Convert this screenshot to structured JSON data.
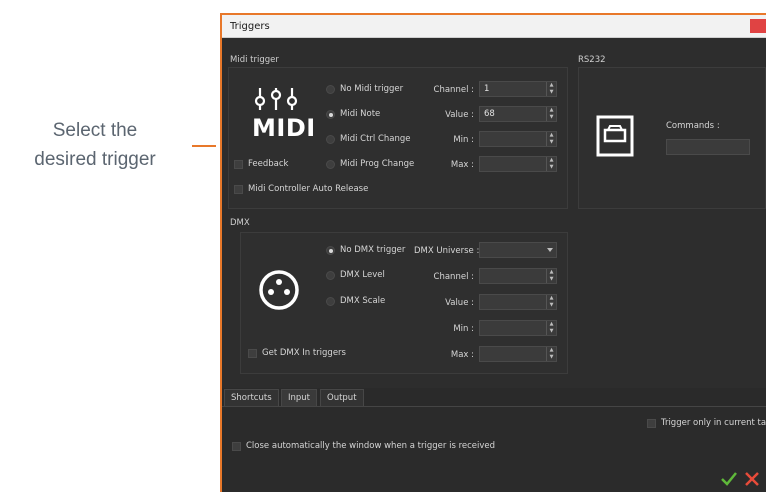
{
  "annotation": {
    "line1": "Select the",
    "line2": "desired trigger"
  },
  "window": {
    "title": "Triggers"
  },
  "midi": {
    "section_label": "Midi trigger",
    "logo_text": "MIDI",
    "radios": [
      {
        "label": "No Midi trigger",
        "selected": false
      },
      {
        "label": "Midi Note",
        "selected": true
      },
      {
        "label": "Midi Ctrl Change",
        "selected": false
      },
      {
        "label": "Midi Prog Change",
        "selected": false
      }
    ],
    "fields": [
      {
        "label": "Channel :",
        "value": "1"
      },
      {
        "label": "Value :",
        "value": "68"
      },
      {
        "label": "Min :",
        "value": ""
      },
      {
        "label": "Max :",
        "value": ""
      }
    ],
    "feedback_label": "Feedback",
    "auto_release_label": "Midi Controller Auto Release"
  },
  "rs232": {
    "section_label": "RS232",
    "commands_label": "Commands :",
    "commands_value": ""
  },
  "dmx": {
    "section_label": "DMX",
    "radios": [
      {
        "label": "No DMX trigger",
        "selected": true
      },
      {
        "label": "DMX Level",
        "selected": false
      },
      {
        "label": "DMX Scale",
        "selected": false
      }
    ],
    "universe_label": "DMX Universe :",
    "universe_value": "",
    "fields": [
      {
        "label": "Channel :",
        "value": ""
      },
      {
        "label": "Value :",
        "value": ""
      },
      {
        "label": "Min :",
        "value": ""
      },
      {
        "label": "Max :",
        "value": ""
      }
    ],
    "get_in_label": "Get DMX In triggers"
  },
  "tabs": [
    {
      "label": "Shortcuts",
      "active": false
    },
    {
      "label": "Input",
      "active": true
    },
    {
      "label": "Output",
      "active": false
    }
  ],
  "options": {
    "current_tab_only": "Trigger only in current tab",
    "close_auto": "Close automatically the window when a trigger is received"
  },
  "colors": {
    "accent": "#e8782a",
    "confirm": "#5fb83a",
    "cancel": "#e84b3a"
  },
  "icons": {
    "confirm": "check-icon",
    "cancel": "close-icon"
  }
}
